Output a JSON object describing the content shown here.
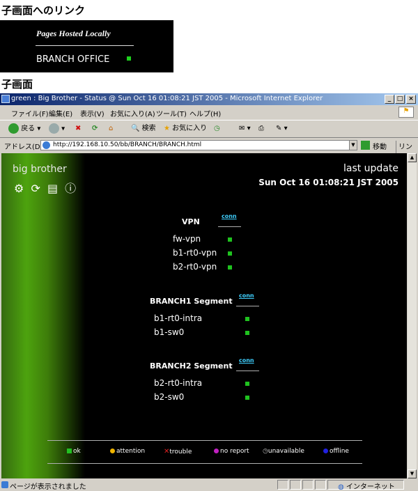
{
  "headings": {
    "link_section": "子画面へのリンク",
    "subscreen": "子画面"
  },
  "mini_panel": {
    "title": "Pages Hosted Locally",
    "item": "BRANCH OFFICE"
  },
  "window": {
    "title": "green : Big Brother - Status @ Sun Oct 16 01:08:21 JST 2005 - Microsoft Internet Explorer",
    "buttons": {
      "min": "_",
      "max": "□",
      "close": "×"
    }
  },
  "menu": [
    "ファイル(F)",
    "編集(E)",
    "表示(V)",
    "お気に入り(A)",
    "ツール(T)",
    "ヘルプ(H)"
  ],
  "toolbar": {
    "back": "戻る",
    "search": "検索",
    "favorites": "お気に入り"
  },
  "address": {
    "label": "アドレス(D)",
    "url": "http://192.168.10.50/bb/BRANCH/BRANCH.html",
    "go": "移動",
    "links": "リンク"
  },
  "page": {
    "brand": "big brother",
    "last_update_label": "last update",
    "last_update_time": "Sun Oct 16 01:08:21 JST 2005",
    "segments": [
      {
        "title": "VPN",
        "col": "conn",
        "hosts": [
          "fw-vpn",
          "b1-rt0-vpn",
          "b2-rt0-vpn"
        ]
      },
      {
        "title": "BRANCH1 Segment",
        "col": "conn",
        "hosts": [
          "b1-rt0-intra",
          "b1-sw0"
        ]
      },
      {
        "title": "BRANCH2 Segment",
        "col": "conn",
        "hosts": [
          "b2-rt0-intra",
          "b2-sw0"
        ]
      }
    ],
    "legend": [
      {
        "label": "ok",
        "color": "#22c022"
      },
      {
        "label": "attention",
        "color": "#f0b400"
      },
      {
        "label": "trouble",
        "color": "#e02020"
      },
      {
        "label": "no report",
        "color": "#c020c0"
      },
      {
        "label": "unavailable",
        "color": "#c0c0c0"
      },
      {
        "label": "offline",
        "color": "#2020e0"
      }
    ]
  },
  "status": {
    "message": "ページが表示されました",
    "zone": "インターネット"
  },
  "colors": {
    "status_green": "#1fc21f",
    "conn_link": "#3fd0ff",
    "titlebar": "#0a246a"
  }
}
